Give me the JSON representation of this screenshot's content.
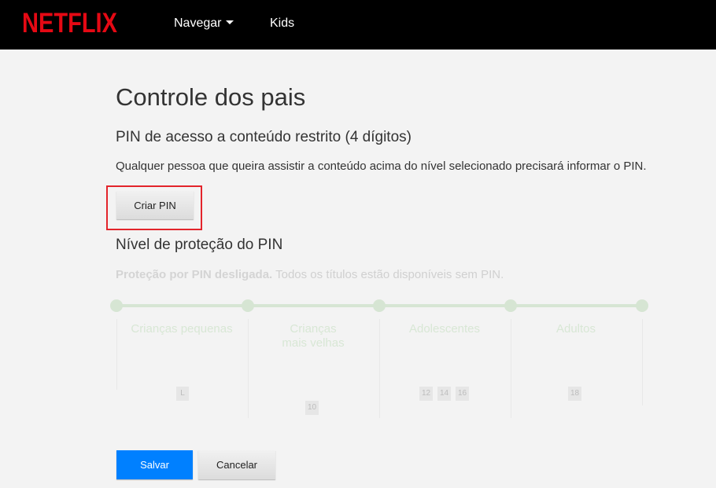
{
  "header": {
    "logo_text": "NETFLIX",
    "nav": {
      "browse_label": "Navegar",
      "kids_label": "Kids"
    }
  },
  "colors": {
    "brand_red": "#e50914",
    "accent_blue": "#0080ff",
    "highlight_red": "#e3242b"
  },
  "main": {
    "title": "Controle dos pais",
    "pin_heading": "PIN de acesso a conteúdo restrito (4 dígitos)",
    "pin_description": "Qualquer pessoa que queira assistir a conteúdo acima do nível selecionado precisará informar o PIN.",
    "create_pin_label": "Criar PIN",
    "level_heading": "Nível de proteção do PIN",
    "level_status_bold": "Proteção por PIN desligada.",
    "level_status_rest": " Todos os títulos estão disponíveis sem PIN."
  },
  "levels": [
    {
      "label": "Crianças pequenas",
      "ratings": [
        "L"
      ]
    },
    {
      "label": "Crianças mais velhas",
      "ratings": [
        "10"
      ]
    },
    {
      "label": "Adolescentes",
      "ratings": [
        "12",
        "14",
        "16"
      ]
    },
    {
      "label": "Adultos",
      "ratings": [
        "18"
      ]
    }
  ],
  "actions": {
    "save_label": "Salvar",
    "cancel_label": "Cancelar"
  }
}
